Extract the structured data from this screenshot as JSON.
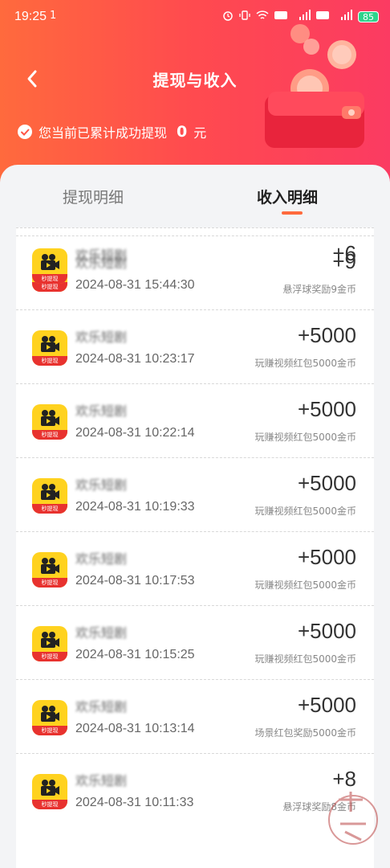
{
  "status_bar": {
    "time": "19:25",
    "extra": "1",
    "battery": "85"
  },
  "header": {
    "title": "提现与收入",
    "summary_prefix": "您当前已累计成功提现",
    "summary_amount": "0",
    "summary_unit": "元"
  },
  "tabs": [
    {
      "label": "提现明细",
      "active": false
    },
    {
      "label": "收入明细",
      "active": true
    }
  ],
  "app_badge": "秒提现",
  "rows": [
    {
      "title": "欢乐短剧",
      "time": "2024-08-31 15:44:30",
      "amount": "+9",
      "desc": "悬浮球奖励9金币"
    },
    {
      "title": "欢乐短剧",
      "time": "2024-08-31 10:23:17",
      "amount": "+5000",
      "desc": "玩赚视频红包5000金币"
    },
    {
      "title": "欢乐短剧",
      "time": "2024-08-31 10:22:14",
      "amount": "+5000",
      "desc": "玩赚视频红包5000金币"
    },
    {
      "title": "欢乐短剧",
      "time": "2024-08-31 10:19:33",
      "amount": "+5000",
      "desc": "玩赚视频红包5000金币"
    },
    {
      "title": "欢乐短剧",
      "time": "2024-08-31 10:17:53",
      "amount": "+5000",
      "desc": "玩赚视频红包5000金币"
    },
    {
      "title": "欢乐短剧",
      "time": "2024-08-31 10:15:25",
      "amount": "+5000",
      "desc": "玩赚视频红包5000金币"
    },
    {
      "title": "欢乐短剧",
      "time": "2024-08-31 10:13:14",
      "amount": "+5000",
      "desc": "场景红包奖励5000金币"
    },
    {
      "title": "欢乐短剧",
      "time": "2024-08-31 10:11:33",
      "amount": "+8",
      "desc": "悬浮球奖励8金币"
    },
    {
      "title": "欢乐短剧",
      "time": "",
      "amount": "+6",
      "desc": ""
    }
  ],
  "colors": {
    "accent": "#ff6a3d",
    "header_start": "#ff6a3d",
    "header_end": "#fb3b62"
  }
}
